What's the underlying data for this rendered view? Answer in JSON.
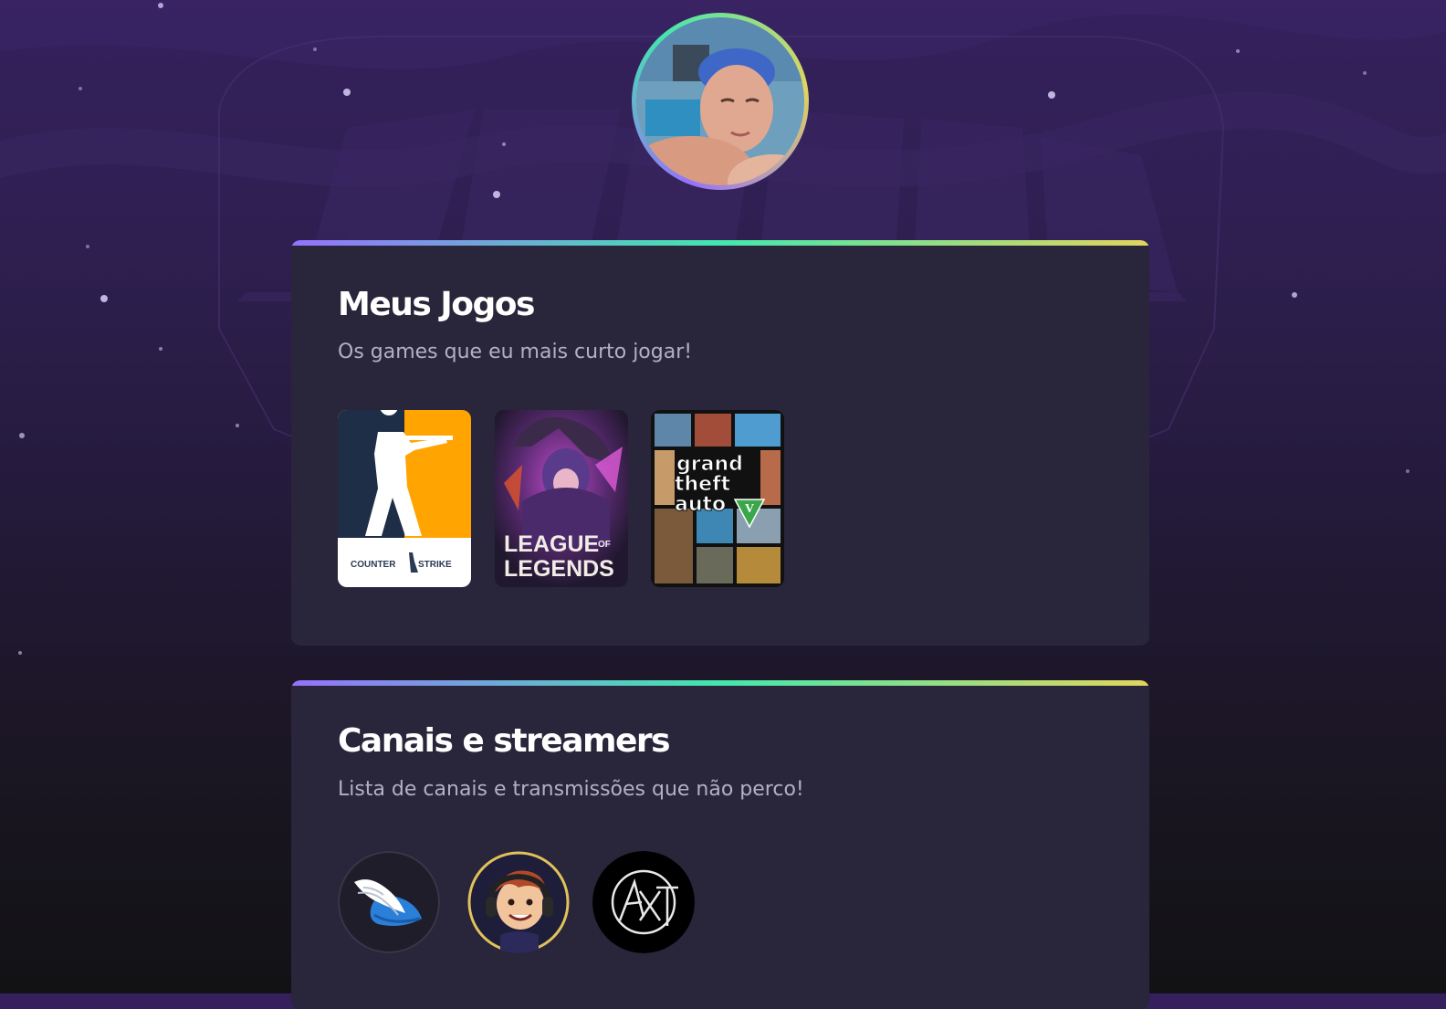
{
  "profile": {
    "avatar_alt": "Foto de perfil"
  },
  "games_section": {
    "title": "Meus Jogos",
    "subtitle": "Os games que eu mais curto jogar!",
    "games": [
      {
        "name": "Counter-Strike",
        "logo_line_left": "COUNTER",
        "logo_line_right": "STRIKE",
        "accent": "#ffa400"
      },
      {
        "name": "League of Legends",
        "logo_line1": "LEAGUE",
        "logo_of": "OF",
        "logo_line2": "LEGENDS"
      },
      {
        "name": "Grand Theft Auto",
        "logo_line1": "grand",
        "logo_line2": "theft",
        "logo_line3": "auto",
        "logo_badge": "V"
      }
    ]
  },
  "channels_section": {
    "title": "Canais e streamers",
    "subtitle": "Lista de canais e transmissões que não perco!",
    "channels": [
      {
        "name": "channel-wing-cap"
      },
      {
        "name": "channel-streamer"
      },
      {
        "name": "channel-axt"
      }
    ]
  },
  "colors": {
    "gradient_start": "#9572fc",
    "gradient_mid": "#43e7ad",
    "gradient_end": "#e1d55d",
    "card_background": "#29253a",
    "subtitle_text": "#b4b0c4"
  }
}
